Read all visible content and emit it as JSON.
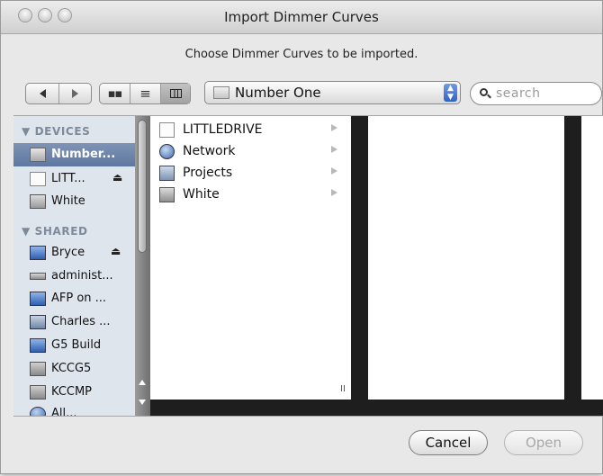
{
  "window": {
    "title": "Import Dimmer Curves"
  },
  "prompt": "Choose Dimmer Curves to be imported.",
  "toolbar": {
    "nav": {
      "back_icon": "back-arrow-icon",
      "forward_icon": "forward-arrow-icon"
    },
    "view_modes": [
      "icon-view",
      "list-view",
      "column-view"
    ],
    "location_popup": {
      "value": "Number One"
    },
    "search": {
      "placeholder": "search"
    }
  },
  "sidebar": {
    "devices_header": "DEVICES",
    "devices": [
      {
        "label": "Number...",
        "selected": true
      },
      {
        "label": "LITT...",
        "eject": true
      },
      {
        "label": "White"
      }
    ],
    "shared_header": "SHARED",
    "shared": [
      {
        "label": "Bryce",
        "eject": true
      },
      {
        "label": "administ..."
      },
      {
        "label": "AFP on ..."
      },
      {
        "label": "Charles ..."
      },
      {
        "label": "G5 Build"
      },
      {
        "label": "KCCG5"
      },
      {
        "label": "KCCMP"
      },
      {
        "label": "All..."
      }
    ]
  },
  "column1": {
    "items": [
      {
        "label": "LITTLEDRIVE",
        "icon": "drive-icon"
      },
      {
        "label": "Network",
        "icon": "network-globe-icon"
      },
      {
        "label": "Projects",
        "icon": "server-icon"
      },
      {
        "label": "White",
        "icon": "drive-icon"
      }
    ]
  },
  "buttons": {
    "cancel": "Cancel",
    "open": "Open"
  }
}
